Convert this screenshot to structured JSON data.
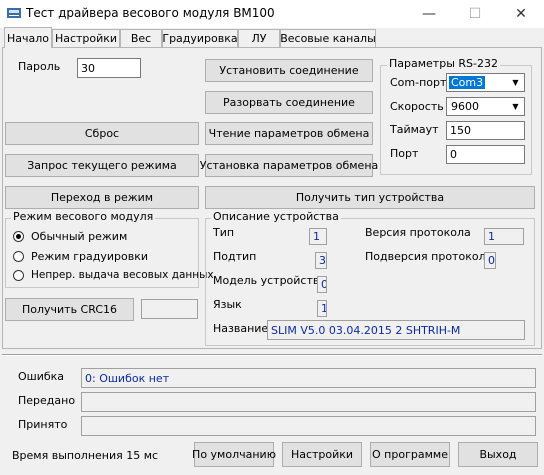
{
  "window": {
    "title": "Тест драйвера весового модуля ВМ100",
    "minimize": "—",
    "maximize": "☐",
    "close": "✕"
  },
  "tabs": [
    {
      "label": "Начало"
    },
    {
      "label": "Настройки"
    },
    {
      "label": "Вес"
    },
    {
      "label": "Градуировка"
    },
    {
      "label": "ЛУ"
    },
    {
      "label": "Весовые каналы"
    }
  ],
  "start": {
    "password_label": "Пароль",
    "password_value": "30",
    "connect_button": "Установить соединение",
    "disconnect_button": "Разорвать соединение",
    "read_params_button": "Чтение параметров обмена",
    "set_params_button": "Установка параметров обмена",
    "reset_button": "Сброс",
    "query_mode_button": "Запрос текущего режима",
    "switch_mode_button": "Переход в режим",
    "get_device_type_button": "Получить тип устройства",
    "get_crc_button": "Получить CRC16",
    "crc_value": "",
    "rs232": {
      "legend": "Параметры RS-232",
      "com_label": "Com-порт",
      "com_value": "Com3",
      "speed_label": "Скорость",
      "speed_value": "9600",
      "timeout_label": "Таймаут",
      "timeout_value": "150",
      "port_label": "Порт",
      "port_value": "0"
    },
    "mode_group": {
      "legend": "Режим весового модуля",
      "options": [
        {
          "label": "Обычный режим",
          "checked": true
        },
        {
          "label": "Режим градуировки",
          "checked": false
        },
        {
          "label": "Непрер. выдача весовых данных",
          "checked": false
        }
      ]
    },
    "device": {
      "legend": "Описание устройства",
      "type_label": "Тип",
      "type_value": "1",
      "subtype_label": "Подтип",
      "subtype_value": "3",
      "model_label": "Модель устройства",
      "model_value": "0",
      "lang_label": "Язык",
      "lang_value": "1",
      "proto_label": "Версия протокола",
      "proto_value": "1",
      "subproto_label": "Подверсия протокола",
      "subproto_value": "0",
      "name_label": "Название",
      "name_value": "SLIM   V5.0 03.04.2015 2 SHTRIH-M"
    }
  },
  "status": {
    "error_label": "Ошибка",
    "error_value": "0: Ошибок нет",
    "sent_label": "Передано",
    "sent_value": "",
    "received_label": "Принято",
    "received_value": ""
  },
  "footer": {
    "exec_time": "Время выполнения 15 мс",
    "defaults_button": "По умолчанию",
    "settings_button": "Настройки",
    "about_button": "О программе",
    "exit_button": "Выход"
  }
}
